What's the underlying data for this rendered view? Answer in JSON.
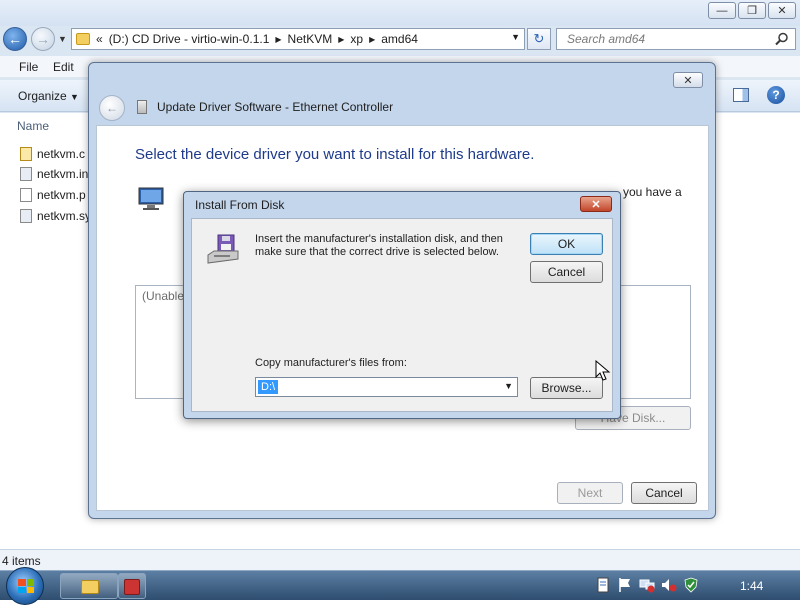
{
  "explorer": {
    "address": {
      "crumbs": [
        "«",
        "(D:) CD Drive - virtio-win-0.1.1",
        "NetKVM",
        "xp",
        "amd64"
      ]
    },
    "search_placeholder": "Search amd64",
    "menu": {
      "file": "File",
      "edit": "Edit"
    },
    "toolbar": {
      "organize": "Organize"
    },
    "column_header": "Name",
    "files": [
      "netkvm.c",
      "netkvm.in",
      "netkvm.p",
      "netkvm.sy"
    ],
    "status": "4 items"
  },
  "update_dialog": {
    "title": "Update Driver Software - Ethernet Controller",
    "heading": "Select the device driver you want to install for this hardware.",
    "bg_text_fragment": "you have a",
    "model_list_text": "(Unable",
    "have_disk_label": "Have Disk...",
    "next_label": "Next",
    "cancel_label": "Cancel"
  },
  "install_dialog": {
    "title": "Install From Disk",
    "message": "Insert the manufacturer's installation disk, and then make sure that the correct drive is selected below.",
    "ok_label": "OK",
    "cancel_label": "Cancel",
    "copy_label": "Copy manufacturer's files from:",
    "copy_value": "D:\\",
    "browse_label": "Browse..."
  },
  "taskbar": {
    "clock": "1:44"
  },
  "colors": {
    "heading_blue": "#1e3a8a",
    "selection_blue": "#3399ff",
    "close_red": "#c1462a"
  }
}
